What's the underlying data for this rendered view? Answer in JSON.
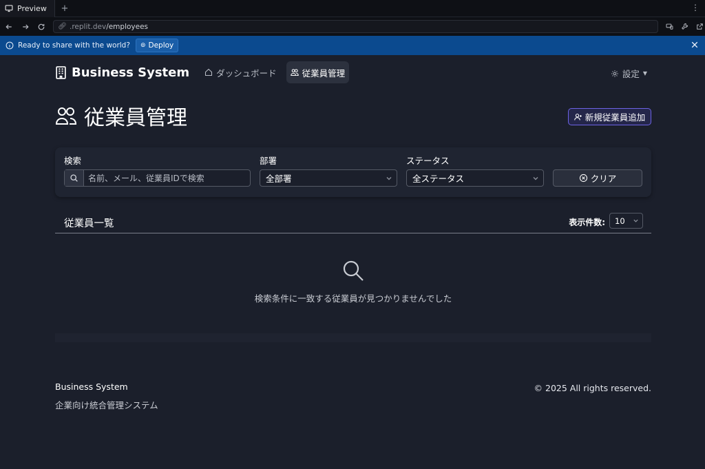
{
  "browser": {
    "tab_title": "Preview",
    "new_tab": "+",
    "url_host": ".replit.dev",
    "url_path": "/employees",
    "banner_text": "Ready to share with the world?",
    "deploy_label": "Deploy"
  },
  "header": {
    "brand": "Business System",
    "nav": [
      {
        "label": "ダッシュボード",
        "icon": "home-icon",
        "active": false
      },
      {
        "label": "従業員管理",
        "icon": "users-icon",
        "active": true
      }
    ],
    "settings_label": "設定"
  },
  "page": {
    "title": "従業員管理",
    "add_button": "新規従業員追加"
  },
  "filters": {
    "search_label": "検索",
    "search_placeholder": "名前、メール、従業員IDで検索",
    "department_label": "部署",
    "department_value": "全部署",
    "status_label": "ステータス",
    "status_value": "全ステータス",
    "clear_label": "クリア"
  },
  "list": {
    "title": "従業員一覧",
    "per_page_label": "表示件数:",
    "per_page_value": "10",
    "empty_message": "検索条件に一致する従業員が見つかりませんでした"
  },
  "footer": {
    "name": "Business System",
    "subtitle": "企業向け統合管理システム",
    "copyright": "© 2025 All rights reserved."
  },
  "colors": {
    "background": "#1b1f2b",
    "accent": "#6d63e6",
    "banner": "#0b4a8f"
  }
}
